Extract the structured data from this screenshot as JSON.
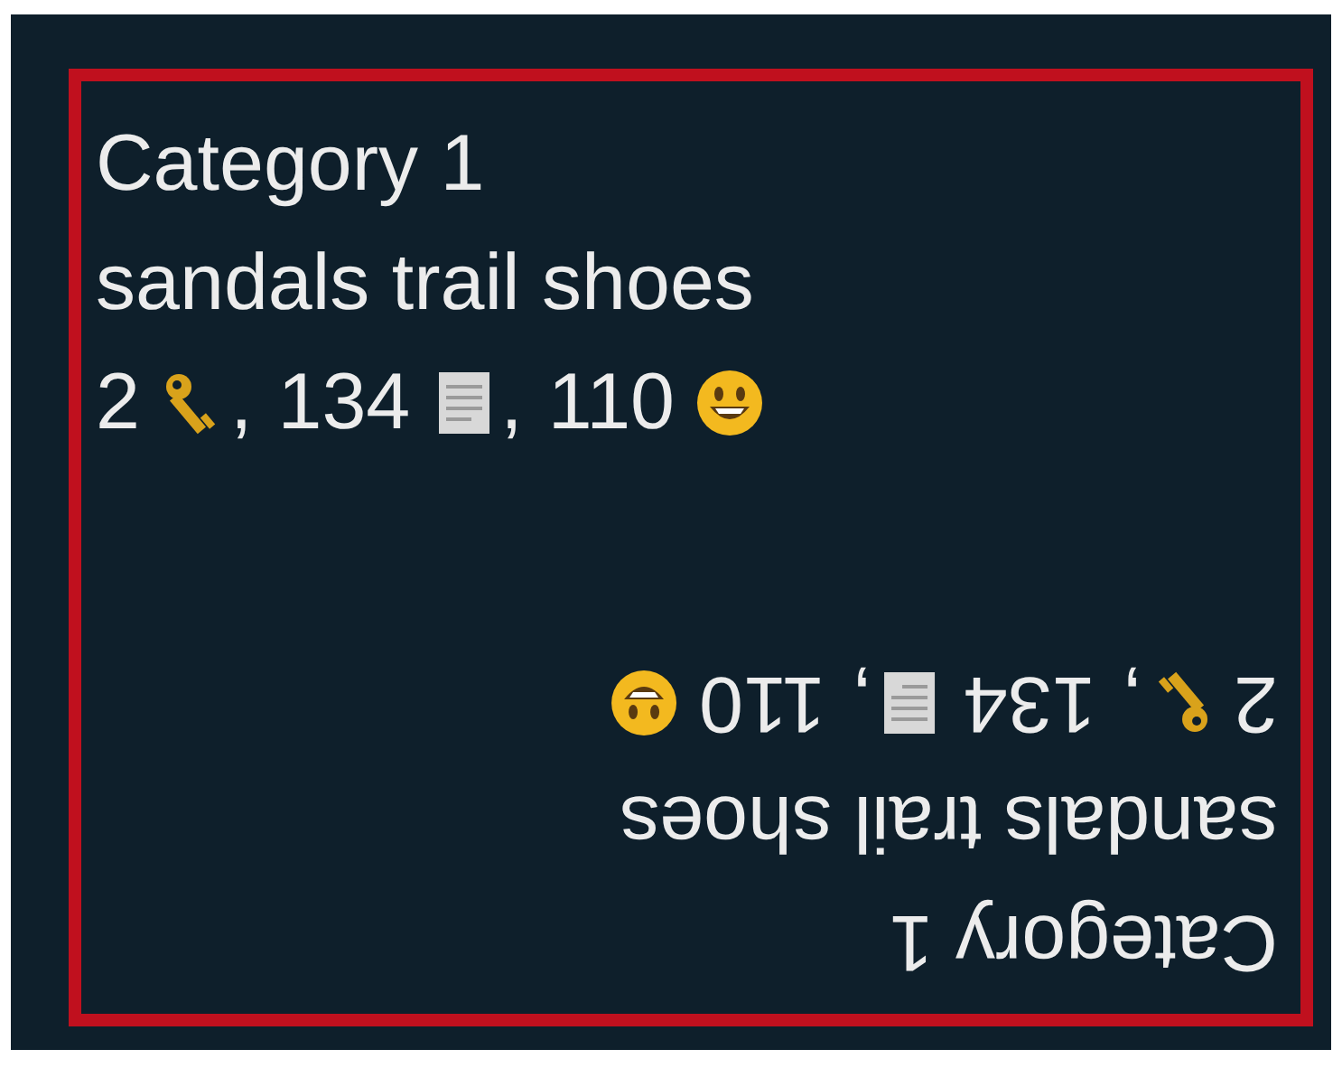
{
  "tile": {
    "category": "Category 1",
    "keywords": "sandals trail shoes",
    "stats": [
      {
        "value": "2",
        "kind": "key",
        "sep": ","
      },
      {
        "value": "134",
        "kind": "document",
        "sep": ","
      },
      {
        "value": "110",
        "kind": "smiley"
      }
    ]
  },
  "mirrored_tile": {
    "category": "Category 1",
    "keywords": "sandals trail shoes",
    "stats": [
      {
        "value": "2",
        "kind": "key",
        "sep": ","
      },
      {
        "value": "134",
        "kind": "document",
        "sep": ","
      },
      {
        "value": "110",
        "kind": "smiley"
      }
    ]
  }
}
